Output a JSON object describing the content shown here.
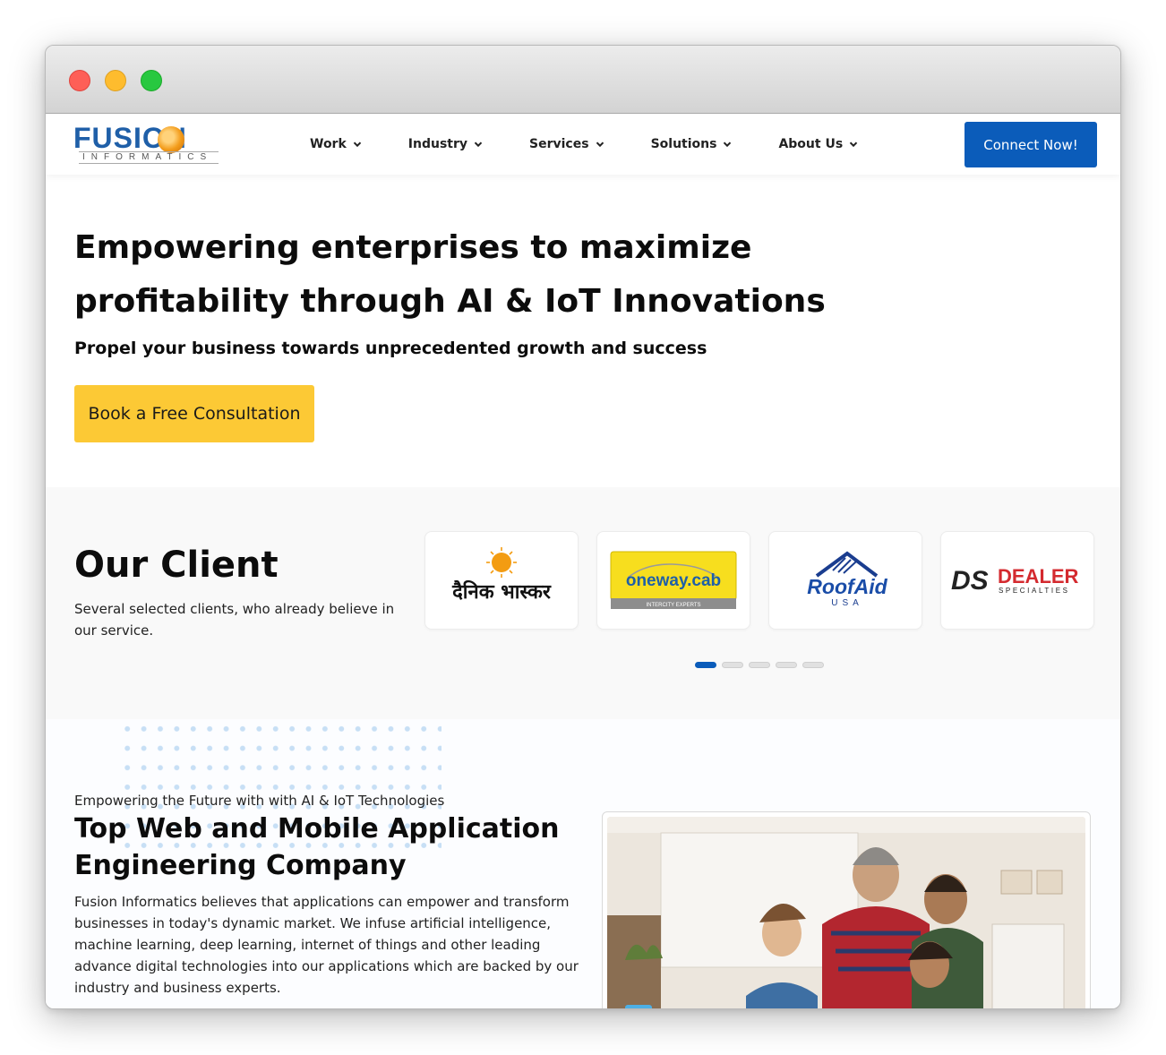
{
  "header": {
    "logo_text": "FUSION",
    "logo_subtext": "INFORMATICS",
    "nav": [
      {
        "label": "Work"
      },
      {
        "label": "Industry"
      },
      {
        "label": "Services"
      },
      {
        "label": "Solutions"
      },
      {
        "label": "About Us"
      }
    ],
    "connect_label": "Connect Now!"
  },
  "hero": {
    "title": "Empowering enterprises to maximize profitability through AI & IoT Innovations",
    "subtitle": "Propel your business towards unprecedented growth and success",
    "cta_label": "Book a Free Consultation"
  },
  "clients": {
    "heading": "Our Client",
    "description": "Several selected clients, who already believe in our service.",
    "logos": [
      {
        "name": "दैनिक भास्कर"
      },
      {
        "name": "oneway.cab",
        "tagline": "INTERCITY EXPERTS"
      },
      {
        "name": "RoofAid",
        "tagline": "USA"
      },
      {
        "name": "DEALER",
        "tagline": "SPECIALTIES",
        "mark": "DS"
      }
    ],
    "carousel_pages": 5,
    "active_page": 1
  },
  "about": {
    "eyebrow": "Empowering the Future with with AI & IoT Technologies",
    "heading": "Top Web and Mobile Application Engineering Company",
    "body": "Fusion Informatics believes that applications can empower and transform businesses in today's dynamic market. We infuse artificial intelligence, machine learning, deep learning, internet of things and other leading advance digital technologies into our applications which are backed by our industry and business experts."
  },
  "colors": {
    "brand_blue": "#0b5cba",
    "cta_yellow": "#fcc935",
    "text_dark": "#0c0c0c"
  }
}
